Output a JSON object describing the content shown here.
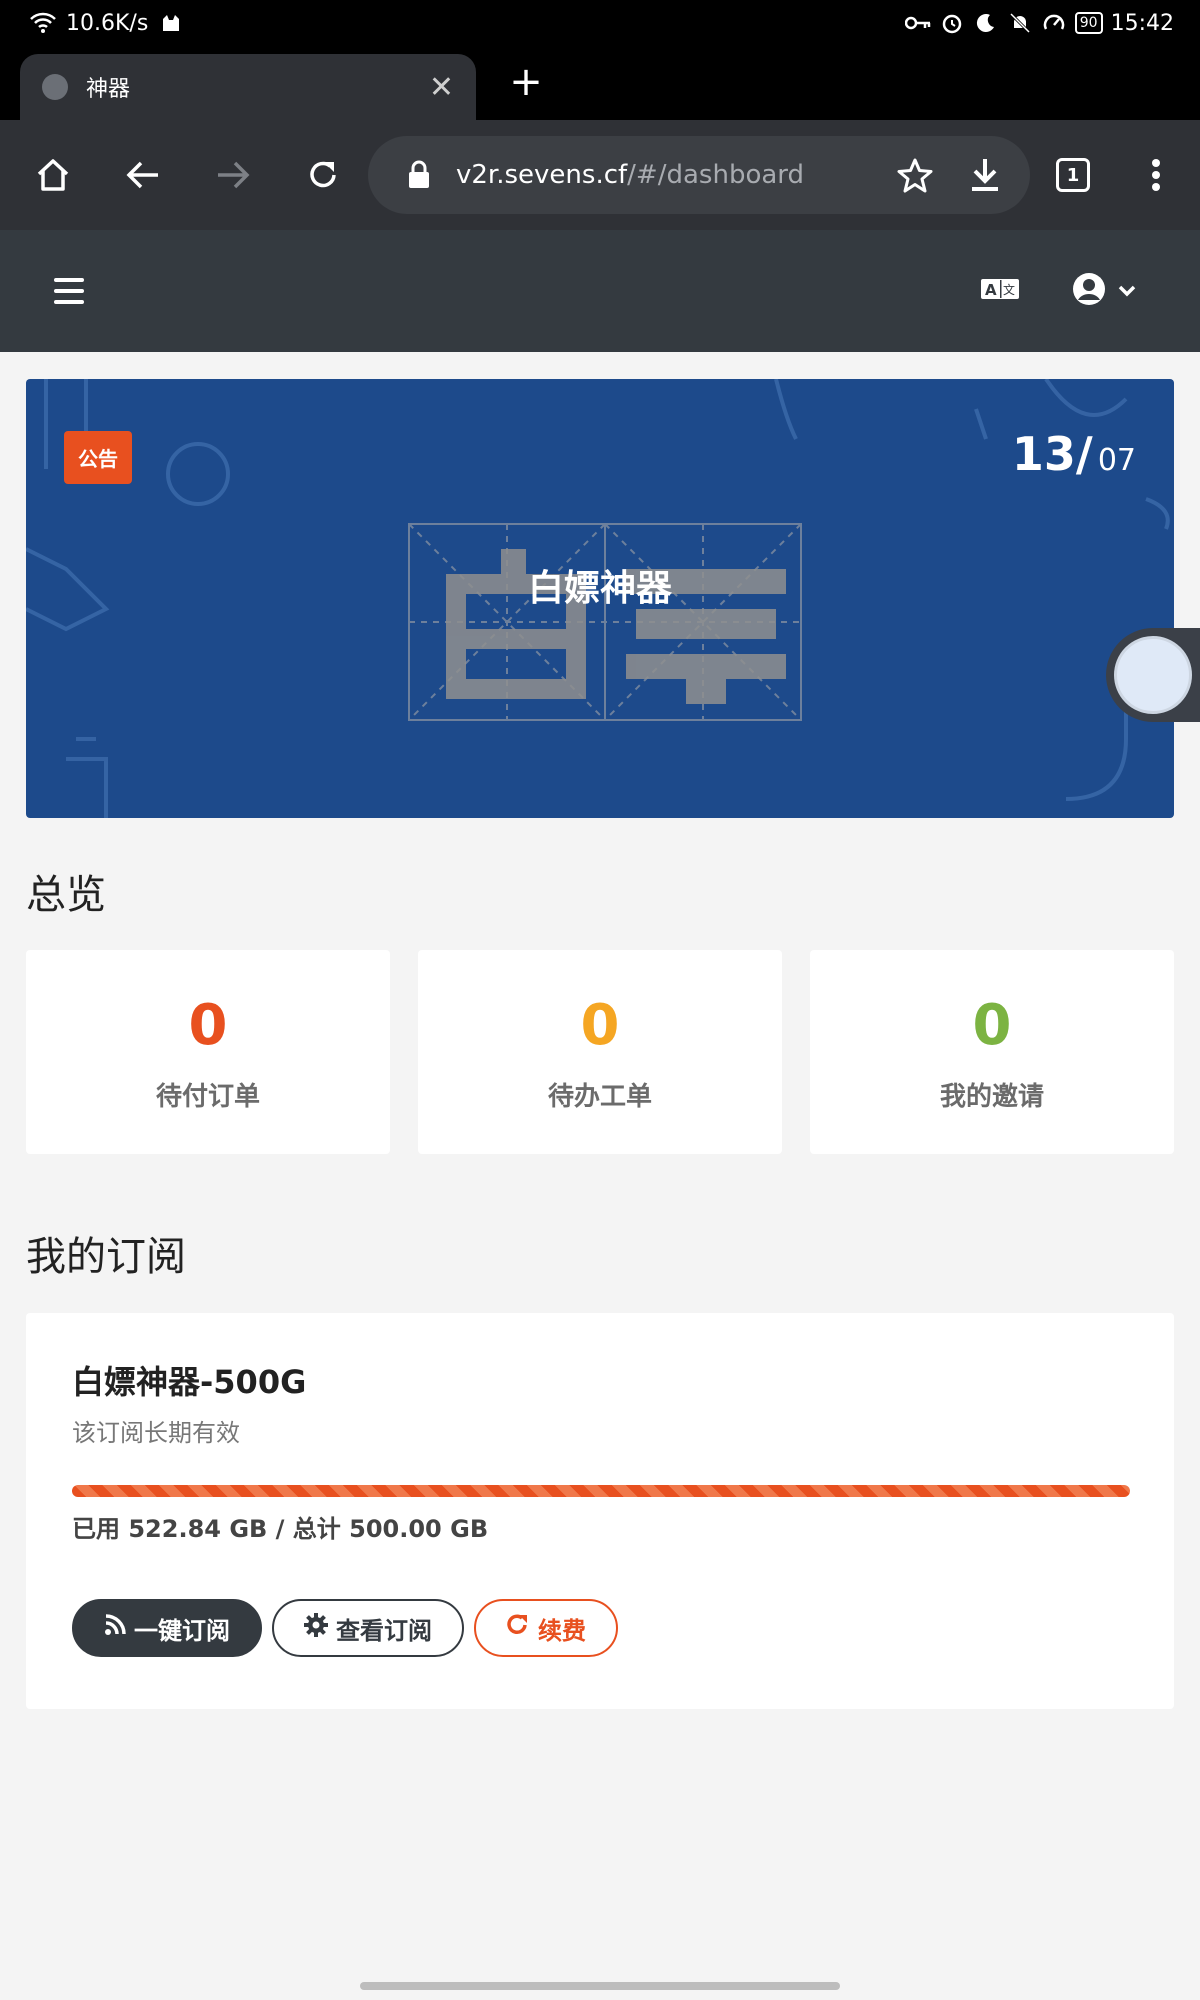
{
  "status_bar": {
    "net_speed": "10.6K/s",
    "battery": "90",
    "time": "15:42"
  },
  "browser": {
    "tab_title": "神器",
    "url_host": "v2r.sevens.cf",
    "url_path": "/#/dashboard",
    "tab_count": "1"
  },
  "banner": {
    "badge": "公告",
    "day": "13/",
    "month": "07",
    "title": "白嫖神器"
  },
  "overview": {
    "title": "总览",
    "stats": [
      {
        "value": "0",
        "label": "待付订单",
        "color": "#e8501f"
      },
      {
        "value": "0",
        "label": "待办工单",
        "color": "#f5a623"
      },
      {
        "value": "0",
        "label": "我的邀请",
        "color": "#7cb342"
      }
    ]
  },
  "subscription": {
    "section_title": "我的订阅",
    "name": "白嫖神器-500G",
    "description": "该订阅长期有效",
    "used_fraction": 1.0,
    "usage_text": "已用 522.84 GB / 总计 500.00 GB",
    "buttons": {
      "subscribe": "一键订阅",
      "view": "查看订阅",
      "renew": "续费"
    }
  },
  "colors": {
    "accent": "#e8501f",
    "header": "#343a40",
    "banner": "#1d4a8b"
  }
}
